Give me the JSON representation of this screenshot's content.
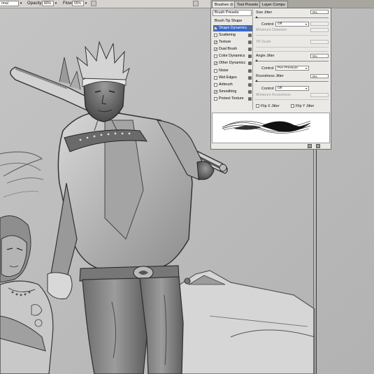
{
  "options_bar": {
    "mode_value": "rmal",
    "opacity_label": "Opacity:",
    "opacity_value": "80%",
    "flow_label": "Flow:",
    "flow_value": "55%"
  },
  "panel_tabs": [
    {
      "label": "Brushes",
      "active": true
    },
    {
      "label": "Tool Presets",
      "active": false
    },
    {
      "label": "Layer Comps",
      "active": false
    }
  ],
  "brushes": {
    "presets_label": "Brush Presets",
    "tip_shape_label": "Brush Tip Shape",
    "options": [
      {
        "label": "Shape Dynamics",
        "checked": true,
        "selected": true
      },
      {
        "label": "Scattering",
        "checked": false,
        "selected": false
      },
      {
        "label": "Texture",
        "checked": true,
        "selected": false
      },
      {
        "label": "Dual Brush",
        "checked": true,
        "selected": false
      },
      {
        "label": "Color Dynamics",
        "checked": false,
        "selected": false
      },
      {
        "label": "Other Dynamics",
        "checked": true,
        "selected": false
      },
      {
        "label": "Noise",
        "checked": false,
        "selected": false
      },
      {
        "label": "Wet Edges",
        "checked": false,
        "selected": false
      },
      {
        "label": "Airbrush",
        "checked": false,
        "selected": false
      },
      {
        "label": "Smoothing",
        "checked": true,
        "selected": false
      },
      {
        "label": "Protect Texture",
        "checked": false,
        "selected": false
      }
    ],
    "size_jitter_label": "Size Jitter",
    "size_jitter_value": "0%",
    "size_control_label": "Control:",
    "size_control_value": "Off",
    "min_diameter_label": "Minimum Diameter",
    "tilt_scale_label": "Tilt Scale",
    "angle_jitter_label": "Angle Jitter",
    "angle_jitter_value": "0%",
    "angle_control_label": "Control:",
    "angle_control_value": "Pen Pressure",
    "roundness_jitter_label": "Roundness Jitter",
    "roundness_jitter_value": "0%",
    "roundness_control_label": "Control:",
    "roundness_control_value": "Off",
    "min_roundness_label": "Minimum Roundness",
    "flip_x_label": "Flip X Jitter",
    "flip_y_label": "Flip Y Jitter",
    "check_mark": "✓",
    "dropdown_arrow": "▾"
  },
  "icons": {
    "tab_close": "close-icon",
    "lock": "lock-icon",
    "new_brush": "new-brush-icon",
    "delete": "trash-icon"
  },
  "colors": {
    "selection": "#3a68c8",
    "panel_bg": "#ebe9e5",
    "canvas_bg": "#c0c0c0"
  }
}
